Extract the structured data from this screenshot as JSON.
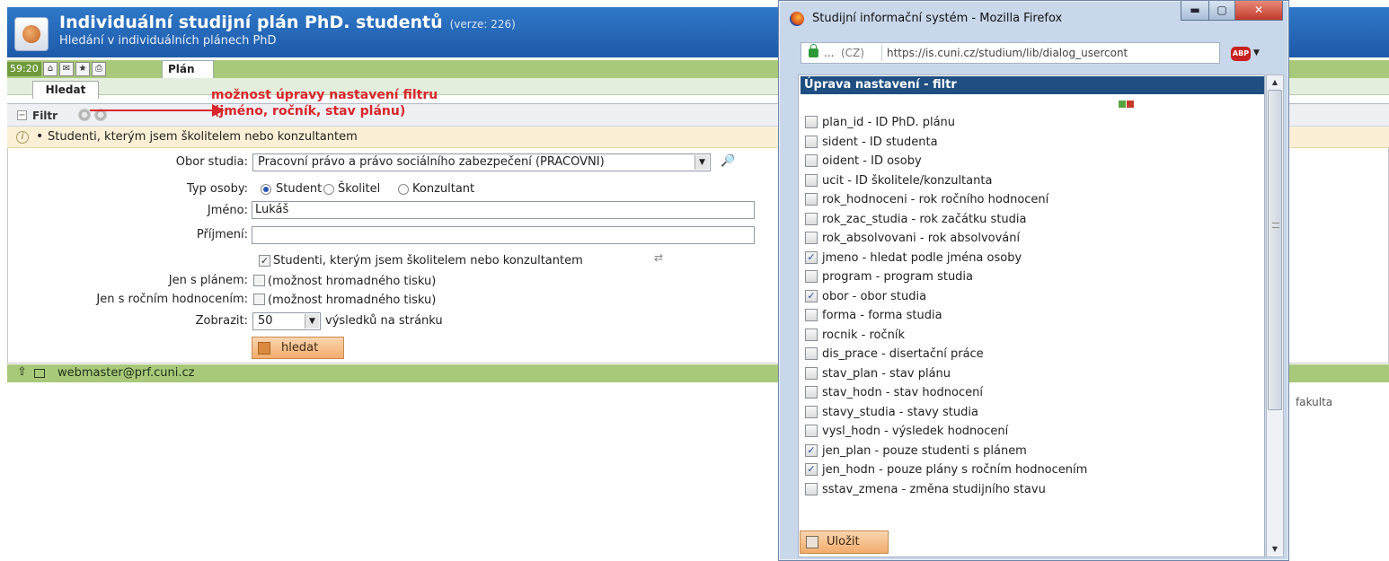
{
  "header": {
    "title": "Individuální studijní plán PhD. studentů",
    "version": "(verze: 226)",
    "subtitle": "Hledání v individuálních plánech PhD"
  },
  "toolbar": {
    "timer": "59:20",
    "tab_plan": "Plán",
    "tab_hledat": "Hledat"
  },
  "annotation": {
    "line1": "možnost úpravy nastavení filtru",
    "line2": "(jméno, ročník, stav plánu)"
  },
  "filter": {
    "label": "Filtr",
    "info": "Studenti, kterým jsem školitelem nebo konzultantem"
  },
  "form": {
    "obor_label": "Obor studia:",
    "obor_value": "Pracovní právo a právo sociálního zabezpečení (PRACOVNI)",
    "typ_label": "Typ osoby:",
    "typ_options": [
      "Student",
      "Školitel",
      "Konzultant"
    ],
    "jmeno_label": "Jméno:",
    "jmeno_value": "Lukáš",
    "prijmeni_label": "Příjmení:",
    "prijmeni_value": "",
    "skolitel_check": "Studenti, kterým jsem školitelem nebo konzultantem",
    "jen_plan_label": "Jen s plánem:",
    "jen_plan_text": "(možnost hromadného tisku)",
    "jen_hodn_label": "Jen s ročním hodnocením:",
    "jen_hodn_text": "(možnost hromadného tisku)",
    "zobrazit_label": "Zobrazit:",
    "zobrazit_value": "50",
    "zobrazit_suffix": "výsledků na stránku",
    "search_button": "hledat"
  },
  "footer": {
    "email": "webmaster@prf.cuni.cz",
    "fakulta": "fakulta"
  },
  "popup": {
    "window_title": "Studijní informační systém - Mozilla Firefox",
    "url_ellipsis": "...",
    "url_cz": "(CZ)",
    "url": "https://is.cuni.cz/studium/lib/dialog_usercont",
    "abp": "ABP",
    "heading": "Úprava nastavení - filtr",
    "items": [
      {
        "label": "plan_id - ID PhD. plánu",
        "checked": false
      },
      {
        "label": "sident - ID studenta",
        "checked": false
      },
      {
        "label": "oident - ID osoby",
        "checked": false
      },
      {
        "label": "ucit - ID školitele/konzultanta",
        "checked": false
      },
      {
        "label": "rok_hodnoceni - rok ročního hodnocení",
        "checked": false
      },
      {
        "label": "rok_zac_studia - rok začátku studia",
        "checked": false
      },
      {
        "label": "rok_absolvovani - rok absolvování",
        "checked": false
      },
      {
        "label": "jmeno - hledat podle jména osoby",
        "checked": true
      },
      {
        "label": "program - program studia",
        "checked": false
      },
      {
        "label": "obor - obor studia",
        "checked": true
      },
      {
        "label": "forma - forma studia",
        "checked": false
      },
      {
        "label": "rocnik - ročník",
        "checked": false
      },
      {
        "label": "dis_prace - disertační práce",
        "checked": false
      },
      {
        "label": "stav_plan - stav plánu",
        "checked": false
      },
      {
        "label": "stav_hodn - stav hodnocení",
        "checked": false
      },
      {
        "label": "stavy_studia - stavy studia",
        "checked": false
      },
      {
        "label": "vysl_hodn - výsledek hodnocení",
        "checked": false
      },
      {
        "label": "jen_plan - pouze studenti s plánem",
        "checked": true
      },
      {
        "label": "jen_hodn - pouze plány s ročním hodnocením",
        "checked": true
      },
      {
        "label": "sstav_zmena - změna studijního stavu",
        "checked": false
      }
    ],
    "save_button": "Uložit"
  }
}
